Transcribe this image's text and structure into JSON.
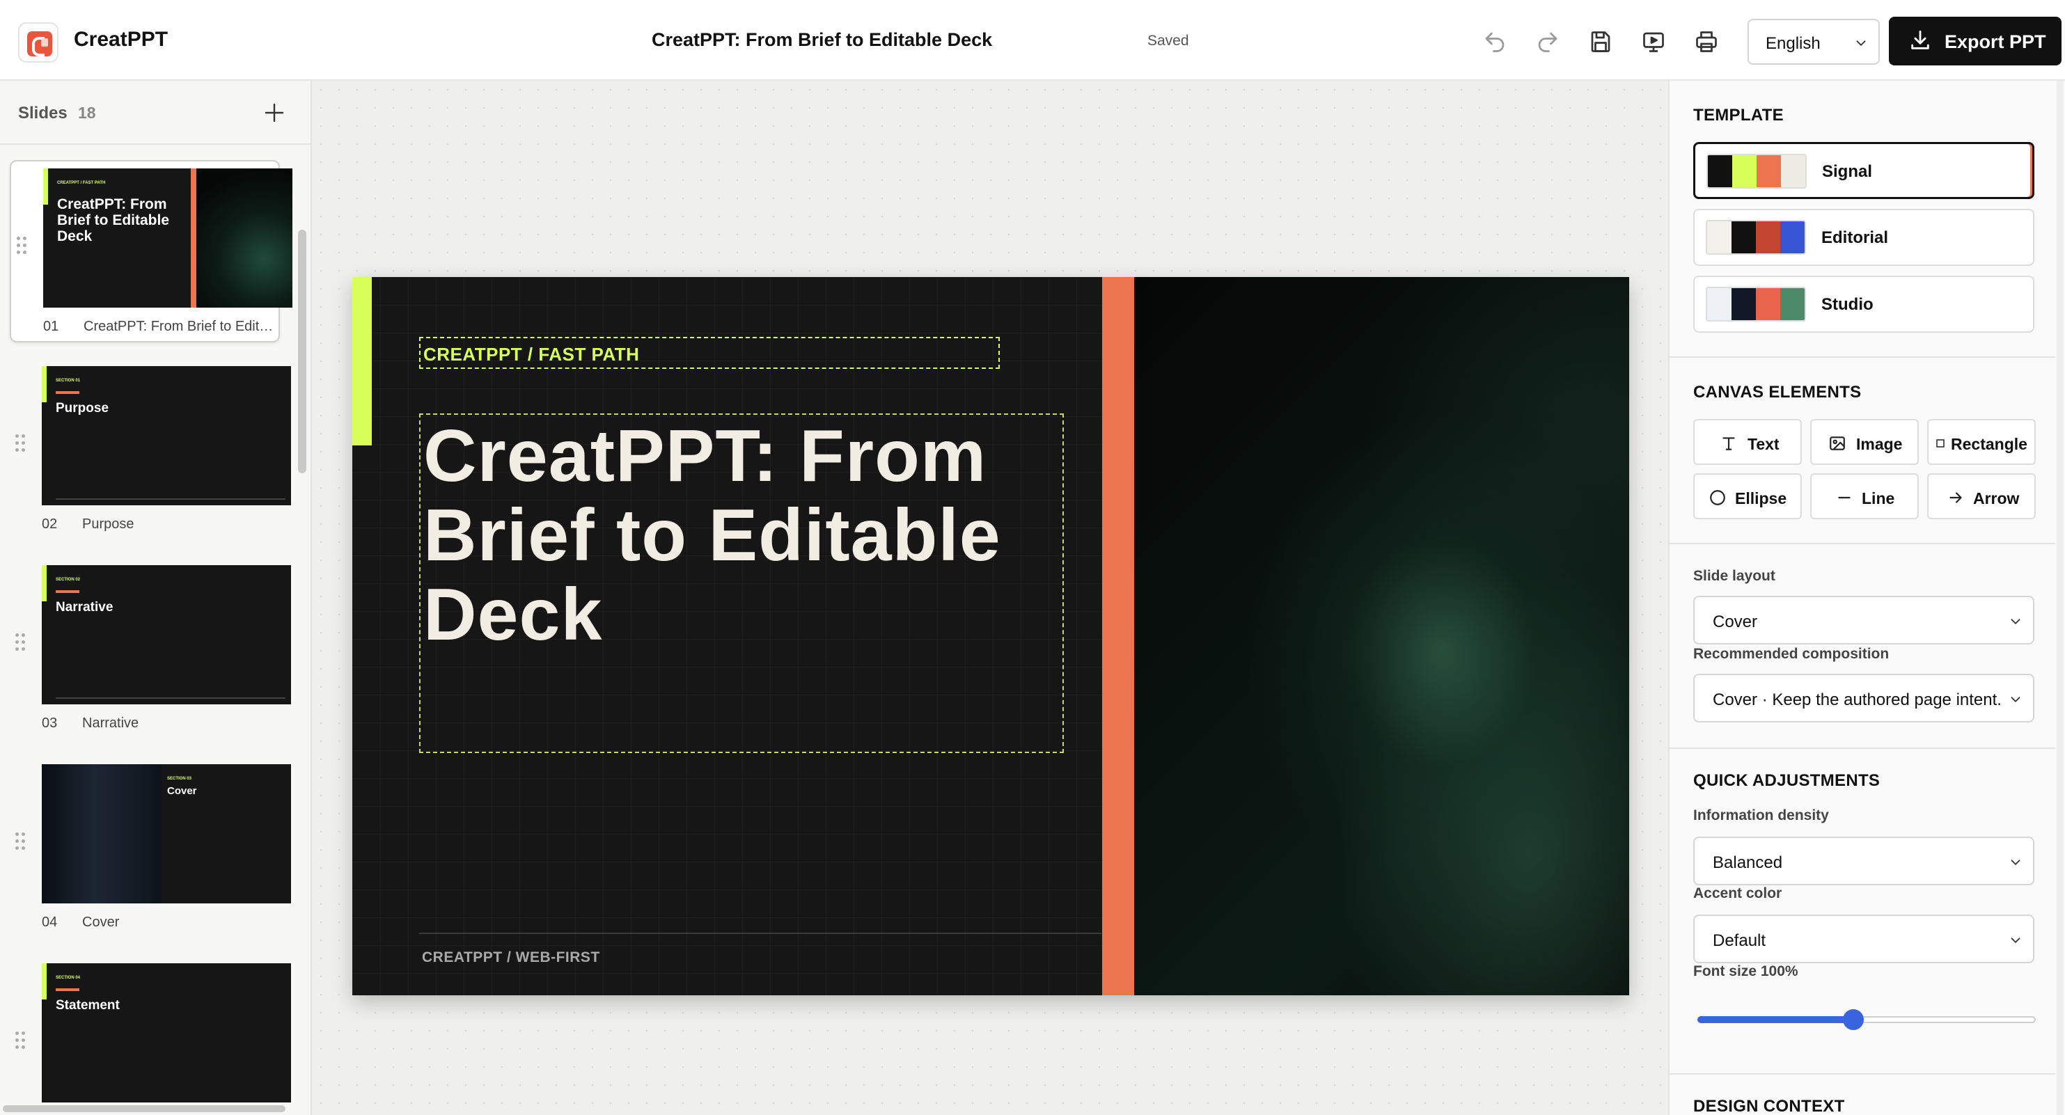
{
  "app": {
    "name": "CreatPPT",
    "doc_title": "CreatPPT: From Brief to Editable Deck",
    "save_status": "Saved"
  },
  "toolbar": {
    "undo_icon": "undo-icon",
    "redo_icon": "redo-icon",
    "save_icon": "save-icon",
    "present_icon": "present-icon",
    "print_icon": "print-icon",
    "language": "English",
    "export_label": "Export PPT"
  },
  "slides_panel": {
    "label": "Slides",
    "count": "18",
    "slides": [
      {
        "num": "01",
        "name": "CreatPPT: From Brief to Editable Deck",
        "thumb_title": "CreatPPT: From Brief to Editable Deck",
        "kicker": "CREATPPT / FAST PATH"
      },
      {
        "num": "02",
        "name": "Purpose",
        "thumb_title": "Purpose",
        "kicker": "SECTION 01"
      },
      {
        "num": "03",
        "name": "Narrative",
        "thumb_title": "Narrative",
        "kicker": "SECTION 02"
      },
      {
        "num": "04",
        "name": "Cover",
        "thumb_title": "Cover",
        "kicker": "SECTION 03"
      },
      {
        "num": "05",
        "name": "Statement",
        "thumb_title": "Statement",
        "kicker": "SECTION 04"
      }
    ]
  },
  "slide": {
    "kicker": "CREATPPT / FAST PATH",
    "title": "CreatPPT: From Brief to Editable Deck",
    "footer": "CREATPPT / WEB-FIRST",
    "colors": {
      "background": "#161616",
      "accent_lime": "#d8ff5a",
      "accent_orange": "#ec7550",
      "title": "#f1ede2"
    }
  },
  "panel": {
    "template_title": "TEMPLATE",
    "templates": [
      {
        "name": "Signal",
        "swatches": [
          "#111111",
          "#d8ff5a",
          "#ec7550",
          "#efece4"
        ]
      },
      {
        "name": "Editorial",
        "swatches": [
          "#f3f1ec",
          "#111111",
          "#c4452f",
          "#3756d6"
        ]
      },
      {
        "name": "Studio",
        "swatches": [
          "#eef2f6",
          "#111827",
          "#e8644a",
          "#4c8a6a"
        ]
      }
    ],
    "canvas_title": "CANVAS ELEMENTS",
    "elements": [
      "Text",
      "Image",
      "Rectangle",
      "Ellipse",
      "Line",
      "Arrow"
    ],
    "slide_layout_label": "Slide layout",
    "slide_layout_value": "Cover",
    "composition_label": "Recommended composition",
    "composition_value": "Cover · Keep the authored page intent.",
    "quick_title": "QUICK ADJUSTMENTS",
    "density_label": "Information density",
    "density_value": "Balanced",
    "accent_label": "Accent color",
    "accent_value": "Default",
    "font_size_label": "Font size 100%",
    "font_size_fraction": 0.46,
    "design_context_title": "DESIGN CONTEXT",
    "slider_color": "#3a63e0"
  }
}
